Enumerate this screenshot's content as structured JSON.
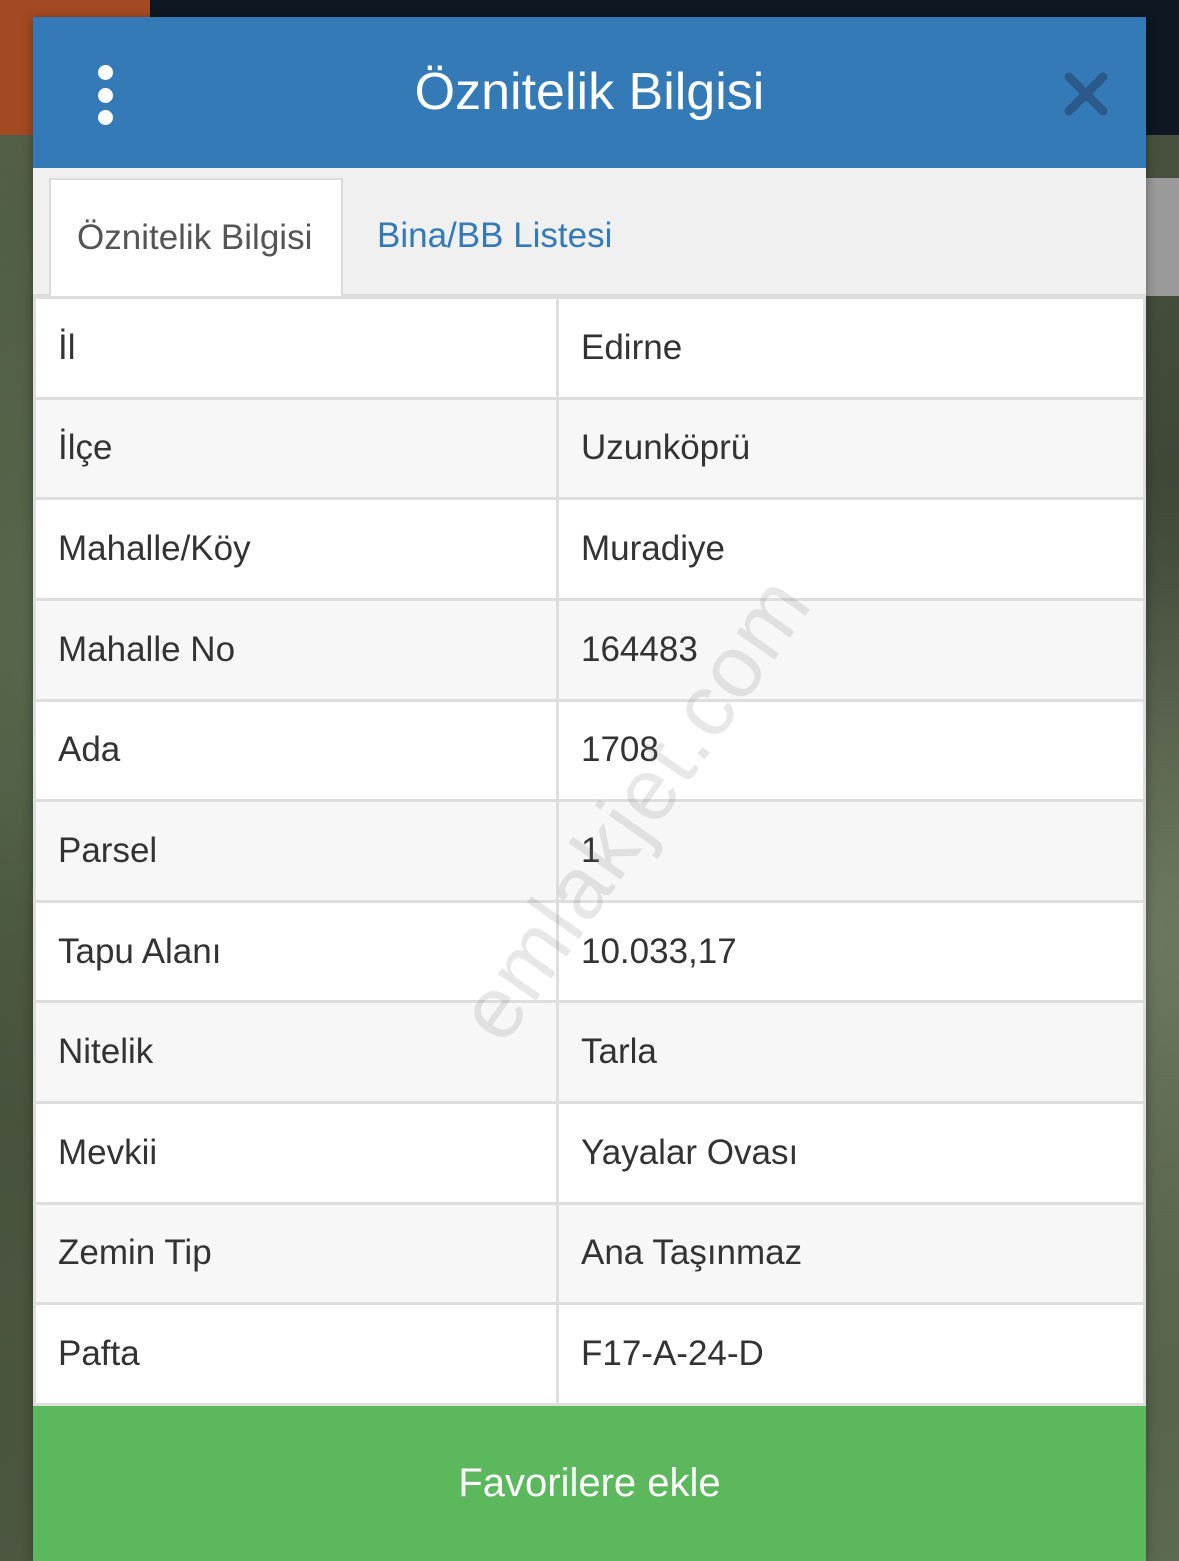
{
  "dialog": {
    "title": "Öznitelik Bilgisi",
    "menu_icon": "more-vertical-icon",
    "close_icon": "close-icon"
  },
  "tabs": [
    {
      "label": "Öznitelik Bilgisi",
      "active": true
    },
    {
      "label": "Bina/BB Listesi",
      "active": false
    }
  ],
  "attributes": [
    {
      "label": "İl",
      "value": "Edirne"
    },
    {
      "label": "İlçe",
      "value": "Uzunköprü"
    },
    {
      "label": "Mahalle/Köy",
      "value": "Muradiye"
    },
    {
      "label": "Mahalle No",
      "value": "164483"
    },
    {
      "label": "Ada",
      "value": "1708"
    },
    {
      "label": "Parsel",
      "value": "1"
    },
    {
      "label": "Tapu Alanı",
      "value": "10.033,17"
    },
    {
      "label": "Nitelik",
      "value": "Tarla"
    },
    {
      "label": "Mevkii",
      "value": "Yayalar Ovası"
    },
    {
      "label": "Zemin Tip",
      "value": "Ana Taşınmaz"
    },
    {
      "label": "Pafta",
      "value": "F17-A-24-D"
    }
  ],
  "watermark": "emlakjet.com",
  "footer": {
    "favorite_label": "Favorilere ekle"
  },
  "colors": {
    "header": "#337ab7",
    "tab_link": "#337ab7",
    "favorite_button": "#5cb85c"
  }
}
